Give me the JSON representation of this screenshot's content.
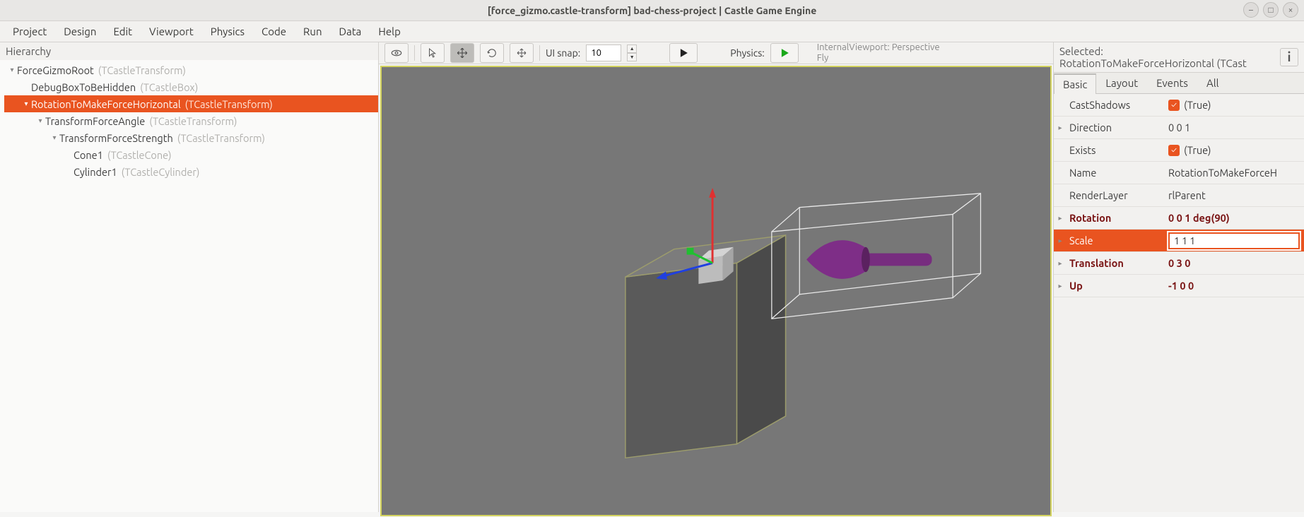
{
  "window": {
    "title": "[force_gizmo.castle-transform] bad-chess-project | Castle Game Engine"
  },
  "menu": [
    "Project",
    "Design",
    "Edit",
    "Viewport",
    "Physics",
    "Code",
    "Run",
    "Data",
    "Help"
  ],
  "hierarchy": {
    "title": "Hierarchy",
    "nodes": [
      {
        "indent": 0,
        "expand": "▾",
        "name": "ForceGizmoRoot",
        "type": "(TCastleTransform)",
        "sel": false
      },
      {
        "indent": 1,
        "expand": "",
        "name": "DebugBoxToBeHidden",
        "type": "(TCastleBox)",
        "sel": false
      },
      {
        "indent": 1,
        "expand": "▾",
        "name": "RotationToMakeForceHorizontal",
        "type": "(TCastleTransform)",
        "sel": true
      },
      {
        "indent": 2,
        "expand": "▾",
        "name": "TransformForceAngle",
        "type": "(TCastleTransform)",
        "sel": false
      },
      {
        "indent": 3,
        "expand": "▾",
        "name": "TransformForceStrength",
        "type": "(TCastleTransform)",
        "sel": false
      },
      {
        "indent": 4,
        "expand": "",
        "name": "Cone1",
        "type": "(TCastleCone)",
        "sel": false
      },
      {
        "indent": 4,
        "expand": "",
        "name": "Cylinder1",
        "type": "(TCastleCylinder)",
        "sel": false
      }
    ]
  },
  "toolbar": {
    "uisnap_label": "UI snap:",
    "uisnap_value": "10",
    "physics_label": "Physics:",
    "vpinfo_line1": "InternalViewport: Perspective",
    "vpinfo_line2": "Fly"
  },
  "selected": {
    "label": "Selected:",
    "value": "RotationToMakeForceHorizontal (TCast"
  },
  "proptabs": [
    "Basic",
    "Layout",
    "Events",
    "All"
  ],
  "props": [
    {
      "exp": "",
      "name": "CastShadows",
      "check": true,
      "val": "(True)",
      "bold": false
    },
    {
      "exp": "▸",
      "name": "Direction",
      "val": "0 0 1",
      "bold": false
    },
    {
      "exp": "",
      "name": "Exists",
      "check": true,
      "val": "(True)",
      "bold": false
    },
    {
      "exp": "",
      "name": "Name",
      "val": "RotationToMakeForceH",
      "bold": false
    },
    {
      "exp": "",
      "name": "RenderLayer",
      "val": "rlParent",
      "bold": false
    },
    {
      "exp": "▸",
      "name": "Rotation",
      "val": "0 0 1 deg(90)",
      "bold": true
    },
    {
      "exp": "▸",
      "name": "Scale",
      "val": "1 1 1",
      "bold": false,
      "selrow": true,
      "edit": true
    },
    {
      "exp": "▸",
      "name": "Translation",
      "val": "0 3 0",
      "bold": true
    },
    {
      "exp": "▸",
      "name": "Up",
      "val": "-1 0 0",
      "bold": true
    }
  ]
}
